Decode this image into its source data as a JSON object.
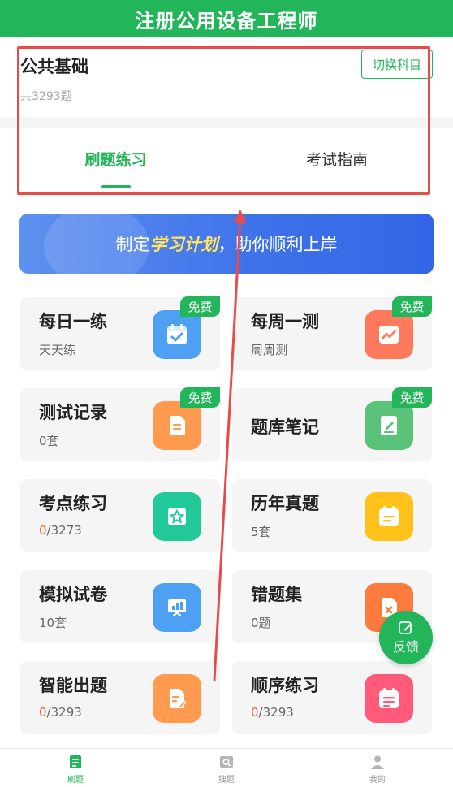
{
  "header": {
    "title": "注册公用设备工程师"
  },
  "subject": {
    "title": "公共基础",
    "count": "共3293题",
    "switch_label": "切换科目"
  },
  "tabs": [
    {
      "label": "刷题练习",
      "active": true
    },
    {
      "label": "考试指南",
      "active": false
    }
  ],
  "banner": {
    "prefix": "制定",
    "highlight": "学习计划",
    "suffix": "，助你顺利上岸"
  },
  "badge_label": "免费",
  "cards": [
    {
      "title": "每日一练",
      "sub": "天天练",
      "free": true,
      "icon": "calendar-check-icon",
      "color": "#4ea0f2"
    },
    {
      "title": "每周一测",
      "sub": "周周测",
      "free": true,
      "icon": "chart-card-icon",
      "color": "#ff7a5c"
    },
    {
      "title": "测试记录",
      "sub": "0套",
      "free": true,
      "icon": "document-icon",
      "color": "#ff9a4e"
    },
    {
      "title": "题库笔记",
      "sub": "",
      "free": true,
      "icon": "notebook-icon",
      "color": "#5bc27a"
    },
    {
      "title": "考点练习",
      "sub_progress": "0",
      "sub_total": "/3273",
      "icon": "star-card-icon",
      "color": "#20c997"
    },
    {
      "title": "历年真题",
      "sub": "5套",
      "icon": "calendar-list-icon",
      "color": "#ffc21a"
    },
    {
      "title": "模拟试卷",
      "sub": "10套",
      "icon": "presentation-icon",
      "color": "#4ea0f2"
    },
    {
      "title": "错题集",
      "sub": "0题",
      "icon": "wrong-doc-icon",
      "color": "#ff7a3d"
    },
    {
      "title": "智能出题",
      "sub_progress": "0",
      "sub_total": "/3293",
      "icon": "edit-doc-icon",
      "color": "#ff9a4e"
    },
    {
      "title": "顺序练习",
      "sub_progress": "0",
      "sub_total": "/3293",
      "icon": "sequence-calendar-icon",
      "color": "#ff5a7a"
    }
  ],
  "feedback_label": "反馈",
  "bottom_nav": [
    {
      "label": "刷题",
      "icon": "practice-icon",
      "active": true
    },
    {
      "label": "搜题",
      "icon": "search-question-icon",
      "active": false
    },
    {
      "label": "我的",
      "icon": "profile-icon",
      "active": false
    }
  ],
  "colors": {
    "brand": "#23b559",
    "annotation": "#e94b4b",
    "progress": "#ff5b1f"
  }
}
